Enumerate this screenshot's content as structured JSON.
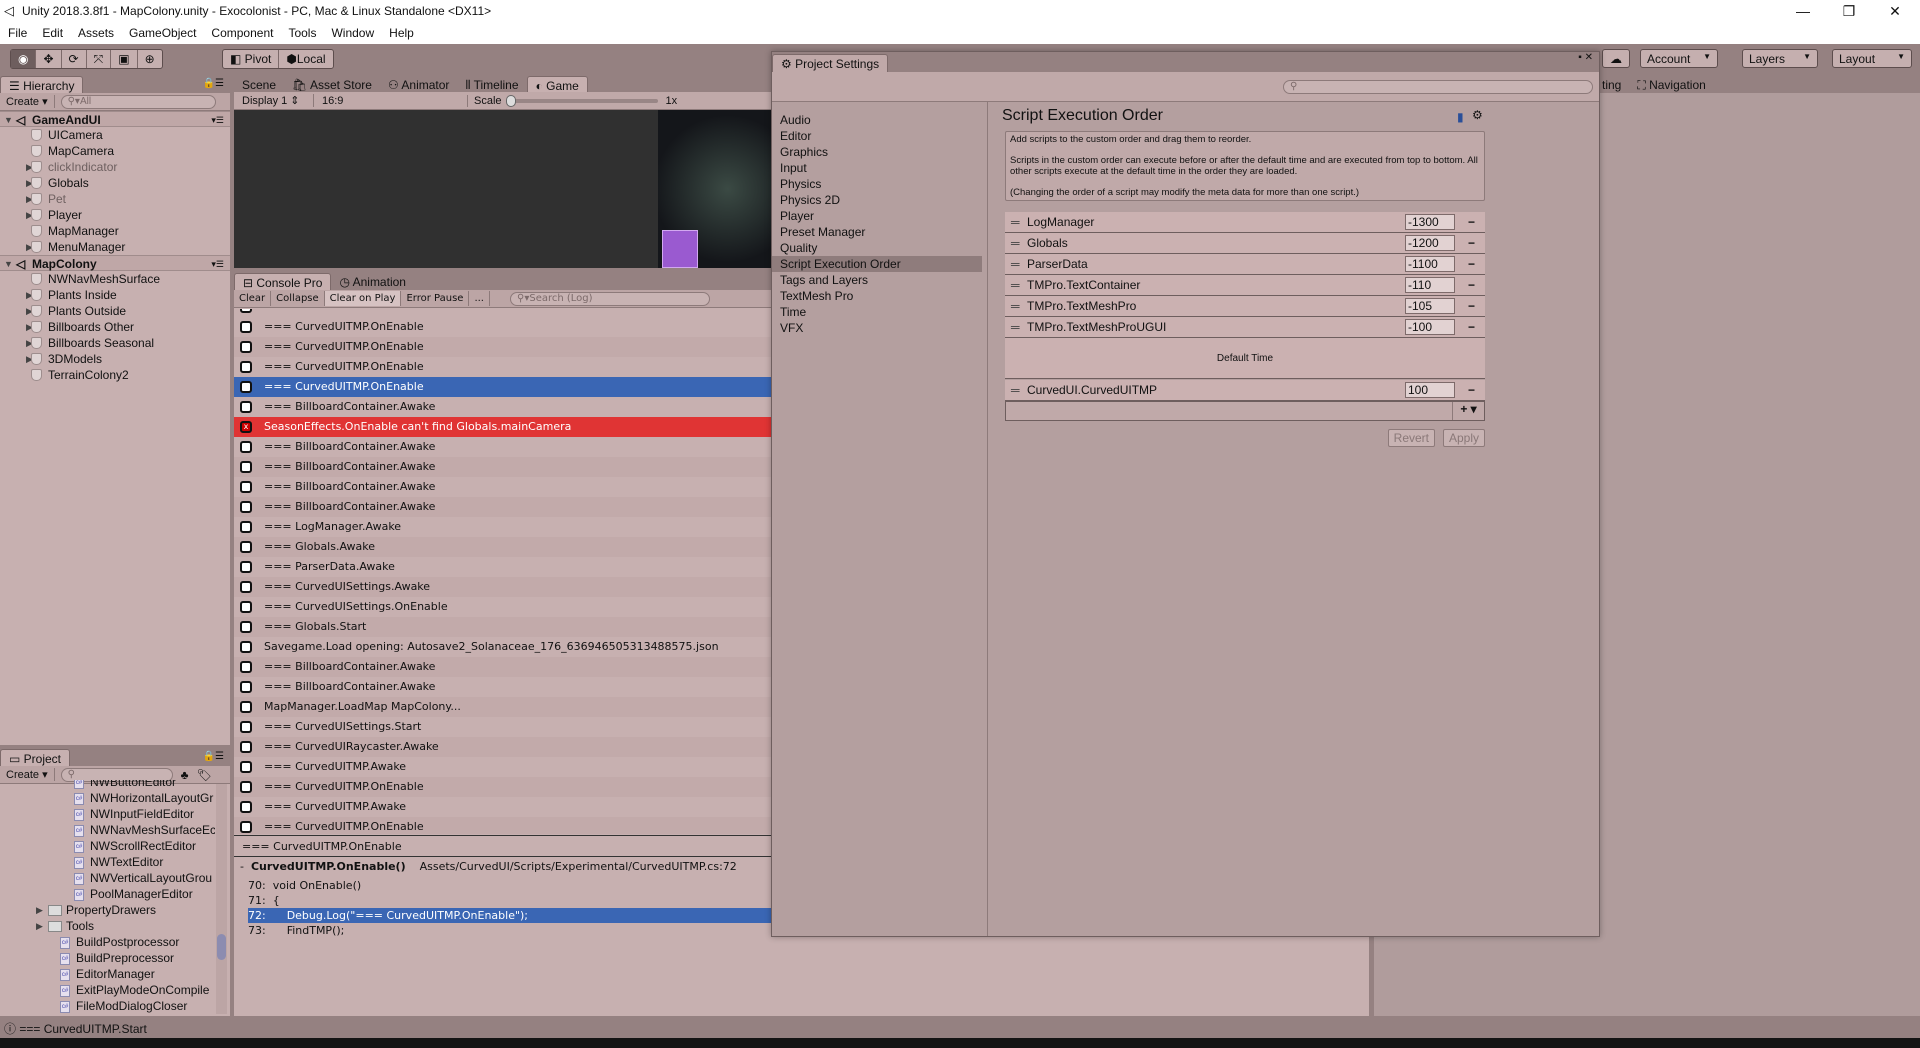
{
  "window": {
    "title": "Unity 2018.3.8f1 - MapColony.unity - Exocolonist - PC, Mac & Linux Standalone <DX11>",
    "minimize": "—",
    "restore": "❐",
    "close": "✕"
  },
  "menu": [
    "File",
    "Edit",
    "Assets",
    "GameObject",
    "Component",
    "Tools",
    "Window",
    "Help"
  ],
  "toolbar": {
    "tools": [
      "view-tool",
      "move-tool",
      "rotate-tool",
      "scale-tool",
      "rect-tool",
      "transform-tool"
    ],
    "tool_glyphs": [
      "◉",
      "✥",
      "⟳",
      "⤧",
      "▣",
      "⊕"
    ],
    "pivot": "Pivot",
    "local": "Local",
    "account": "Account",
    "layers": "Layers",
    "layout": "Layout"
  },
  "hierarchy": {
    "tab": "Hierarchy",
    "create": "Create",
    "search_placeholder": "All",
    "items": [
      {
        "label": "GameAndUI",
        "level": 0,
        "scene": true,
        "expandable": true
      },
      {
        "label": "UICamera",
        "level": 1
      },
      {
        "label": "MapCamera",
        "level": 1
      },
      {
        "label": "clickIndicator",
        "level": 1,
        "expandable": true,
        "inactive": true
      },
      {
        "label": "Globals",
        "level": 1,
        "expandable": true
      },
      {
        "label": "Pet",
        "level": 1,
        "expandable": true,
        "inactive": true
      },
      {
        "label": "Player",
        "level": 1,
        "expandable": true
      },
      {
        "label": "MapManager",
        "level": 1
      },
      {
        "label": "MenuManager",
        "level": 1,
        "expandable": true
      },
      {
        "label": "MapColony",
        "level": 0,
        "scene": true,
        "expandable": true
      },
      {
        "label": "NWNavMeshSurface",
        "level": 1
      },
      {
        "label": "Plants Inside",
        "level": 1,
        "expandable": true
      },
      {
        "label": "Plants Outside",
        "level": 1,
        "expandable": true
      },
      {
        "label": "Billboards Other",
        "level": 1,
        "expandable": true
      },
      {
        "label": "Billboards Seasonal",
        "level": 1,
        "expandable": true
      },
      {
        "label": "3DModels",
        "level": 1,
        "expandable": true
      },
      {
        "label": "TerrainColony2",
        "level": 1
      }
    ]
  },
  "center_tabs": [
    "Scene",
    "Asset Store",
    "Animator",
    "Timeline",
    "Game"
  ],
  "game": {
    "display": "Display 1",
    "aspect": "16:9",
    "scale_label": "Scale",
    "scale_value": "1x"
  },
  "console": {
    "tabs": [
      "Console Pro",
      "Animation"
    ],
    "buttons": [
      "Clear",
      "Collapse",
      "Clear on Play",
      "Error Pause",
      "..."
    ],
    "search_placeholder": "Search (Log)",
    "rows": [
      {
        "text": "=== CurvedUITMP.OnEnable",
        "type": "log"
      },
      {
        "text": "=== CurvedUITMP.OnEnable",
        "type": "log"
      },
      {
        "text": "=== CurvedUITMP.OnEnable",
        "type": "log"
      },
      {
        "text": "=== CurvedUITMP.OnEnable",
        "type": "selected"
      },
      {
        "text": "=== BillboardContainer.Awake",
        "type": "log"
      },
      {
        "text": "SeasonEffects.OnEnable can't find Globals.mainCamera",
        "type": "error"
      },
      {
        "text": "=== BillboardContainer.Awake",
        "type": "log"
      },
      {
        "text": "=== BillboardContainer.Awake",
        "type": "log"
      },
      {
        "text": "=== BillboardContainer.Awake",
        "type": "log"
      },
      {
        "text": "=== BillboardContainer.Awake",
        "type": "log"
      },
      {
        "text": "=== LogManager.Awake",
        "type": "log"
      },
      {
        "text": "=== Globals.Awake",
        "type": "log"
      },
      {
        "text": "=== ParserData.Awake",
        "type": "log"
      },
      {
        "text": "=== CurvedUISettings.Awake",
        "type": "log"
      },
      {
        "text": "=== CurvedUISettings.OnEnable",
        "type": "log"
      },
      {
        "text": "=== Globals.Start",
        "type": "log"
      },
      {
        "text": "Savegame.Load opening: Autosave2_Solanaceae_176_636946505313488575.json",
        "type": "log"
      },
      {
        "text": "=== BillboardContainer.Awake",
        "type": "log"
      },
      {
        "text": "=== BillboardContainer.Awake",
        "type": "log"
      },
      {
        "text": "MapManager.LoadMap MapColony...",
        "type": "log"
      },
      {
        "text": "=== CurvedUISettings.Start",
        "type": "log"
      },
      {
        "text": "=== CurvedUIRaycaster.Awake",
        "type": "log"
      },
      {
        "text": "=== CurvedUITMP.Awake",
        "type": "log"
      },
      {
        "text": "=== CurvedUITMP.OnEnable",
        "type": "log"
      },
      {
        "text": "=== CurvedUITMP.Awake",
        "type": "log"
      },
      {
        "text": "=== CurvedUITMP.OnEnable",
        "type": "log"
      }
    ],
    "detail_message": "=== CurvedUITMP.OnEnable",
    "stack_method": "CurvedUITMP.OnEnable()",
    "stack_path": "Assets/CurvedUI/Scripts/Experimental/CurvedUITMP.cs:72",
    "code": [
      {
        "line": "70:",
        "code": "void OnEnable()",
        "highlight": false
      },
      {
        "line": "71:",
        "code": "{",
        "highlight": false
      },
      {
        "line": "72:",
        "code": "    Debug.Log(\"=== CurvedUITMP.OnEnable\");",
        "highlight": true
      },
      {
        "line": "73:",
        "code": "    FindTMP();",
        "highlight": false
      }
    ]
  },
  "project": {
    "tab": "Project",
    "create": "Create",
    "items": [
      {
        "label": "NWButtonEditor",
        "type": "script",
        "indent": 2
      },
      {
        "label": "NWHorizontalLayoutGr",
        "type": "script",
        "indent": 2
      },
      {
        "label": "NWInputFieldEditor",
        "type": "script",
        "indent": 2
      },
      {
        "label": "NWNavMeshSurfaceEc",
        "type": "script",
        "indent": 2
      },
      {
        "label": "NWScrollRectEditor",
        "type": "script",
        "indent": 2
      },
      {
        "label": "NWTextEditor",
        "type": "script",
        "indent": 2
      },
      {
        "label": "NWVerticalLayoutGrou",
        "type": "script",
        "indent": 2
      },
      {
        "label": "PoolManagerEditor",
        "type": "script",
        "indent": 2
      },
      {
        "label": "PropertyDrawers",
        "type": "folder",
        "indent": 1
      },
      {
        "label": "Tools",
        "type": "folder",
        "indent": 1
      },
      {
        "label": "BuildPostprocessor",
        "type": "script",
        "indent": 1
      },
      {
        "label": "BuildPreprocessor",
        "type": "script",
        "indent": 1
      },
      {
        "label": "EditorManager",
        "type": "script",
        "indent": 1
      },
      {
        "label": "ExitPlayModeOnCompile",
        "type": "script",
        "indent": 1
      },
      {
        "label": "FileModDialogCloser",
        "type": "script",
        "indent": 1
      }
    ]
  },
  "right_panel": {
    "tabs": [
      "ting",
      "Navigation"
    ]
  },
  "status_bar": {
    "message": "=== CurvedUITMP.Start"
  },
  "project_settings": {
    "tab": "Project Settings",
    "search_placeholder": "",
    "categories": [
      "Audio",
      "Editor",
      "Graphics",
      "Input",
      "Physics",
      "Physics 2D",
      "Player",
      "Preset Manager",
      "Quality",
      "Script Execution Order",
      "Tags and Layers",
      "TextMesh Pro",
      "Time",
      "VFX"
    ],
    "selected": "Script Execution Order",
    "title": "Script Execution Order",
    "info": [
      "Add scripts to the custom order and drag them to reorder.",
      "Scripts in the custom order can execute before or after the default time and are executed from top to bottom. All other scripts execute at the default time in the order they are loaded.",
      "(Changing the order of a script may modify the meta data for more than one script.)"
    ],
    "before_default": [
      {
        "name": "LogManager",
        "order": "-1300"
      },
      {
        "name": "Globals",
        "order": "-1200"
      },
      {
        "name": "ParserData",
        "order": "-1100"
      },
      {
        "name": "TMPro.TextContainer",
        "order": "-110"
      },
      {
        "name": "TMPro.TextMeshPro",
        "order": "-105"
      },
      {
        "name": "TMPro.TextMeshProUGUI",
        "order": "-100"
      }
    ],
    "default_time": "Default Time",
    "after_default": [
      {
        "name": "CurvedUI.CurvedUITMP",
        "order": "100"
      }
    ],
    "add": "+",
    "remove": "−",
    "revert": "Revert",
    "apply": "Apply"
  },
  "colors": {
    "chrome": "#958181",
    "panel": "#c7b0b0",
    "selected": "#3a66b4",
    "error": "#e03434"
  }
}
